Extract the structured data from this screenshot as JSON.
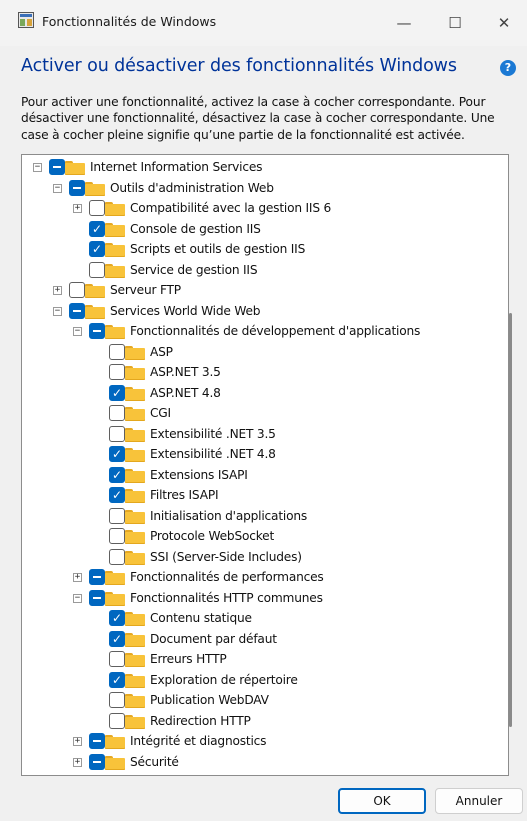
{
  "window": {
    "title": "Fonctionnalités de Windows",
    "minimize_glyph": "—",
    "maximize_glyph": "☐",
    "close_glyph": "✕"
  },
  "heading": "Activer ou désactiver des fonctionnalités Windows",
  "help_glyph": "?",
  "description": "Pour activer une fonctionnalité, activez la case à cocher correspondante. Pour désactiver une fonctionnalité, désactivez la case à cocher correspondante. Une case à cocher pleine signifie qu’une partie de la fonctionnalité est activée.",
  "tree": [
    {
      "label": "Internet Information Services",
      "level": 0,
      "expander": "−",
      "state": "partial"
    },
    {
      "label": "Outils d'administration Web",
      "level": 1,
      "expander": "−",
      "state": "partial"
    },
    {
      "label": "Compatibilité avec la gestion IIS 6",
      "level": 2,
      "expander": "+",
      "state": "unchecked"
    },
    {
      "label": "Console de gestion IIS",
      "level": 2,
      "expander": "",
      "state": "checked"
    },
    {
      "label": "Scripts et outils de gestion IIS",
      "level": 2,
      "expander": "",
      "state": "checked"
    },
    {
      "label": "Service de gestion IIS",
      "level": 2,
      "expander": "",
      "state": "unchecked"
    },
    {
      "label": "Serveur FTP",
      "level": 1,
      "expander": "+",
      "state": "unchecked"
    },
    {
      "label": "Services World Wide Web",
      "level": 1,
      "expander": "−",
      "state": "partial"
    },
    {
      "label": "Fonctionnalités de développement d'applications",
      "level": 2,
      "expander": "−",
      "state": "partial"
    },
    {
      "label": "ASP",
      "level": 3,
      "expander": "",
      "state": "unchecked"
    },
    {
      "label": "ASP.NET 3.5",
      "level": 3,
      "expander": "",
      "state": "unchecked"
    },
    {
      "label": "ASP.NET 4.8",
      "level": 3,
      "expander": "",
      "state": "checked"
    },
    {
      "label": "CGI",
      "level": 3,
      "expander": "",
      "state": "unchecked"
    },
    {
      "label": "Extensibilité .NET 3.5",
      "level": 3,
      "expander": "",
      "state": "unchecked"
    },
    {
      "label": "Extensibilité .NET 4.8",
      "level": 3,
      "expander": "",
      "state": "checked"
    },
    {
      "label": "Extensions ISAPI",
      "level": 3,
      "expander": "",
      "state": "checked"
    },
    {
      "label": "Filtres ISAPI",
      "level": 3,
      "expander": "",
      "state": "checked"
    },
    {
      "label": "Initialisation d'applications",
      "level": 3,
      "expander": "",
      "state": "unchecked"
    },
    {
      "label": "Protocole WebSocket",
      "level": 3,
      "expander": "",
      "state": "unchecked"
    },
    {
      "label": "SSI (Server-Side Includes)",
      "level": 3,
      "expander": "",
      "state": "unchecked"
    },
    {
      "label": "Fonctionnalités de performances",
      "level": 2,
      "expander": "+",
      "state": "partial"
    },
    {
      "label": "Fonctionnalités HTTP communes",
      "level": 2,
      "expander": "−",
      "state": "partial"
    },
    {
      "label": "Contenu statique",
      "level": 3,
      "expander": "",
      "state": "checked"
    },
    {
      "label": "Document par défaut",
      "level": 3,
      "expander": "",
      "state": "checked"
    },
    {
      "label": "Erreurs HTTP",
      "level": 3,
      "expander": "",
      "state": "unchecked"
    },
    {
      "label": "Exploration de répertoire",
      "level": 3,
      "expander": "",
      "state": "checked"
    },
    {
      "label": "Publication WebDAV",
      "level": 3,
      "expander": "",
      "state": "unchecked"
    },
    {
      "label": "Redirection HTTP",
      "level": 3,
      "expander": "",
      "state": "unchecked"
    },
    {
      "label": "Intégrité et diagnostics",
      "level": 2,
      "expander": "+",
      "state": "partial"
    },
    {
      "label": "Sécurité",
      "level": 2,
      "expander": "+",
      "state": "partial"
    }
  ],
  "buttons": {
    "ok": "OK",
    "cancel": "Annuler"
  },
  "colors": {
    "heading": "#003399",
    "checkbox_accent": "#0067c0",
    "folder": "#f8c33a"
  }
}
